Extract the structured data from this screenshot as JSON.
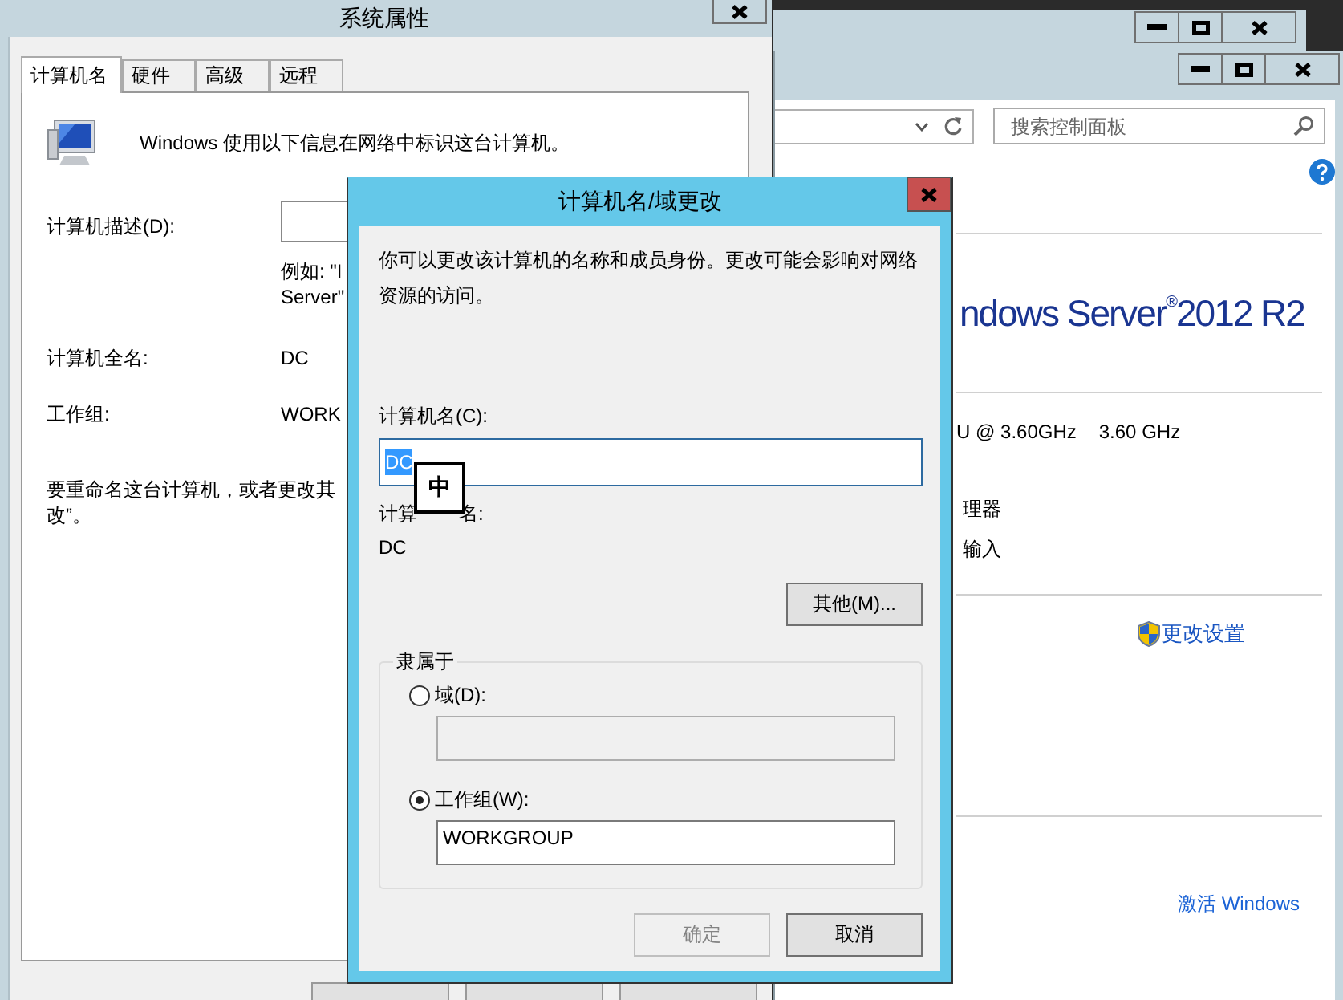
{
  "control_panel": {
    "search": {
      "placeholder": "搜索控制面板"
    },
    "edition": "ndows Server$^{®}$2012 R2",
    "processor": [
      "U @ 3.60GHz",
      "3.60 GHz"
    ],
    "info_lines": [
      "理器",
      "输入"
    ],
    "change_settings": "更改设置",
    "activate": "激活 Windows"
  },
  "system_properties": {
    "title": "系统属性",
    "tabs": [
      {
        "label": "计算机名",
        "selected": true
      },
      {
        "label": "硬件",
        "selected": false
      },
      {
        "label": "高级",
        "selected": false
      },
      {
        "label": "远程",
        "selected": false
      }
    ],
    "intro": "Windows 使用以下信息在网络中标识这台计算机。",
    "description_label": "计算机描述(D):",
    "example": [
      "例如: \"I",
      "Server\""
    ],
    "full_name_label": "计算机全名:",
    "full_name": "DC",
    "workgroup_label": "工作组:",
    "workgroup": "WORK",
    "rename_text": [
      "要重命名这台计算机，或者更改其",
      "改”。"
    ]
  },
  "dialog": {
    "title": "计算机名/域更改",
    "intro": "你可以更改该计算机的名称和成员身份。更改可能会影响对网络资源的访问。",
    "name_label": "计算机名(C):",
    "name_value": "DC",
    "name_selected": true,
    "full_name_label_parts": [
      "计算",
      "名:"
    ],
    "full_name": "DC",
    "more_button": "其他(M)...",
    "member_of": "隶属于",
    "options": [
      {
        "label": "域(D):",
        "selected": false
      },
      {
        "label": "工作组(W):",
        "selected": true,
        "value": "WORKGROUP"
      }
    ],
    "buttons": [
      {
        "label": "确定",
        "disabled": true
      },
      {
        "label": "取消",
        "disabled": false
      }
    ],
    "ime_indicator": "中"
  }
}
